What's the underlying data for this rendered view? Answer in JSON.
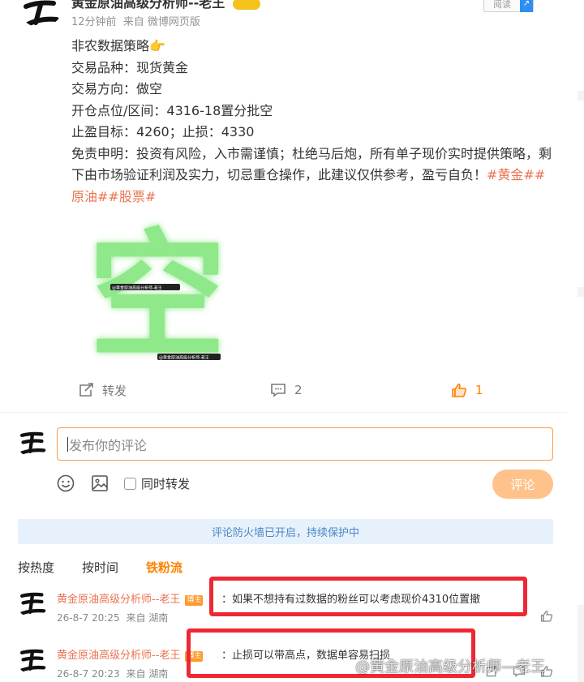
{
  "post": {
    "author": "黄金原油高级分析师--老王",
    "vip_level": "1",
    "time": "12分钟前",
    "source": "来自 微博网页版",
    "read_label": "阅读",
    "lines": [
      "非农数据策略👉",
      "交易品种：现货黄金",
      "交易方向：做空",
      "开仓点位/区间：4316-18置分批空",
      "止盈目标：4260；止损：4330"
    ],
    "disclaimer": "免责申明：投资有风险，入市需谨慎；杜绝马后炮，所有单子现价实时提供策略，剩下由市场验证利润及实力，切忌重仓操作，此建议仅供参考，盈亏自负！",
    "hashtags": "#黄金##原油##股票#",
    "image_char": "空",
    "image_watermark_1": "@黄金原油高级分析师-老王",
    "image_watermark_2": "@黄金原油高级分析师-老王"
  },
  "actions": {
    "repost_label": "转发",
    "comment_count": "2",
    "like_count": "1"
  },
  "composer": {
    "placeholder": "发布你的评论",
    "also_repost_label": "同时转发",
    "submit_label": "评论"
  },
  "firewall_notice": "评论防火墙已开启，持续保护中",
  "sort_tabs": {
    "hot": "按热度",
    "time": "按时间",
    "fans": "铁粉流"
  },
  "comments": [
    {
      "name": "黄金原油高级分析师--老王",
      "badge": "博主",
      "text": "：如果不想持有过数据的粉丝可以考虑现价4310位置撤",
      "time": "26-8-7 20:25",
      "source": "来自 湖南"
    },
    {
      "name": "黄金原油高级分析师--老王",
      "badge": "博主",
      "text": "：止损可以带高点，数据单容易扫损",
      "time": "26-8-7 20:23",
      "source": "来自 湖南"
    }
  ],
  "watermark": "@黄金原油高级分析师—老王",
  "colors": {
    "accent_orange": "#ff8200",
    "link_orange": "#eb7350",
    "highlight_red": "#ee2833",
    "firewall_bg": "#e6f1fc"
  }
}
